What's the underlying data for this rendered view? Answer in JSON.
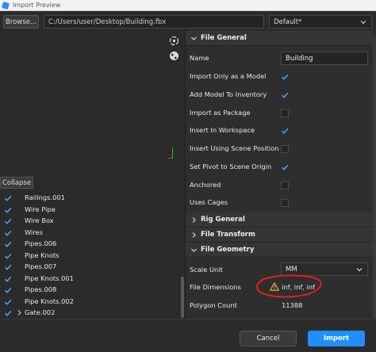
{
  "window": {
    "title": "Import Preview"
  },
  "toolbar": {
    "browse_label": "Browse...",
    "file_path": "C:/Users/user/Desktop/Building.fbx",
    "preset_value": "Default*"
  },
  "tree": {
    "collapse_label": "Collapse",
    "items": [
      {
        "label": "Railings.001",
        "checked": true
      },
      {
        "label": "Wire Pipe",
        "checked": true
      },
      {
        "label": "Wire Box",
        "checked": true
      },
      {
        "label": "Wires",
        "checked": true
      },
      {
        "label": "Pipes.006",
        "checked": true
      },
      {
        "label": "Pipe Knots",
        "checked": true
      },
      {
        "label": "Pipes.007",
        "checked": true
      },
      {
        "label": "Pipe Knots.001",
        "checked": true
      },
      {
        "label": "Pipes.008",
        "checked": true
      },
      {
        "label": "Pipe Knots.002",
        "checked": true
      },
      {
        "label": "Gate.002",
        "checked": true,
        "expandable": true
      }
    ]
  },
  "file_general": {
    "header": "File General",
    "name_label": "Name",
    "name_value": "Building",
    "options": [
      {
        "label": "Import Only as a Model",
        "checked": true
      },
      {
        "label": "Add Model To Inventory",
        "checked": true
      },
      {
        "label": "Import as Package",
        "checked": false
      },
      {
        "label": "Insert In Workspace",
        "checked": true
      },
      {
        "label": "Insert Using Scene Position",
        "checked": false
      },
      {
        "label": "Set Pivot to Scene Origin",
        "checked": true
      },
      {
        "label": "Anchored",
        "checked": false
      },
      {
        "label": "Uses Cages",
        "checked": false
      }
    ]
  },
  "rig_general": {
    "header": "Rig General"
  },
  "file_transform": {
    "header": "File Transform"
  },
  "file_geometry": {
    "header": "File Geometry",
    "scale_unit_label": "Scale Unit",
    "scale_unit_value": "MM",
    "dimensions_label": "File Dimensions",
    "dimensions_value": "inf, inf, inf",
    "polygon_label": "Polygon Count",
    "polygon_value": "11388"
  },
  "footer": {
    "cancel_label": "Cancel",
    "import_label": "Import"
  },
  "colors": {
    "accent": "#1f8fff",
    "checkmark": "#4aa3ff",
    "warning": "#f0b429",
    "annotation": "#e0201c"
  }
}
